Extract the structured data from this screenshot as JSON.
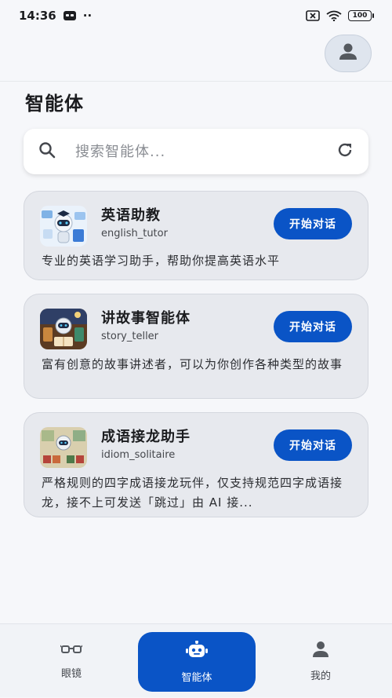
{
  "status_bar": {
    "time": "14:36",
    "dots": "··",
    "battery": "100"
  },
  "page": {
    "title": "智能体"
  },
  "search": {
    "placeholder": "搜索智能体..."
  },
  "agents": [
    {
      "name": "英语助教",
      "id": "english_tutor",
      "description": "专业的英语学习助手，帮助你提高英语水平",
      "button": "开始对话"
    },
    {
      "name": "讲故事智能体",
      "id": "story_teller",
      "description": "富有创意的故事讲述者，可以为你创作各种类型的故事",
      "button": "开始对话"
    },
    {
      "name": "成语接龙助手",
      "id": "idiom_solitaire",
      "description": "严格规则的四字成语接龙玩伴，仅支持规范四字成语接龙，接不上可发送「跳过」由 AI 接...",
      "button": "开始对话"
    }
  ],
  "bottom_nav": [
    {
      "label": "眼镜",
      "icon": "glasses-icon",
      "active": false
    },
    {
      "label": "智能体",
      "icon": "robot-icon",
      "active": true
    },
    {
      "label": "我的",
      "icon": "person-icon",
      "active": false
    }
  ],
  "colors": {
    "accent": "#0a54c6",
    "card_bg": "#e7e9ee",
    "page_bg": "#f6f7fa"
  }
}
